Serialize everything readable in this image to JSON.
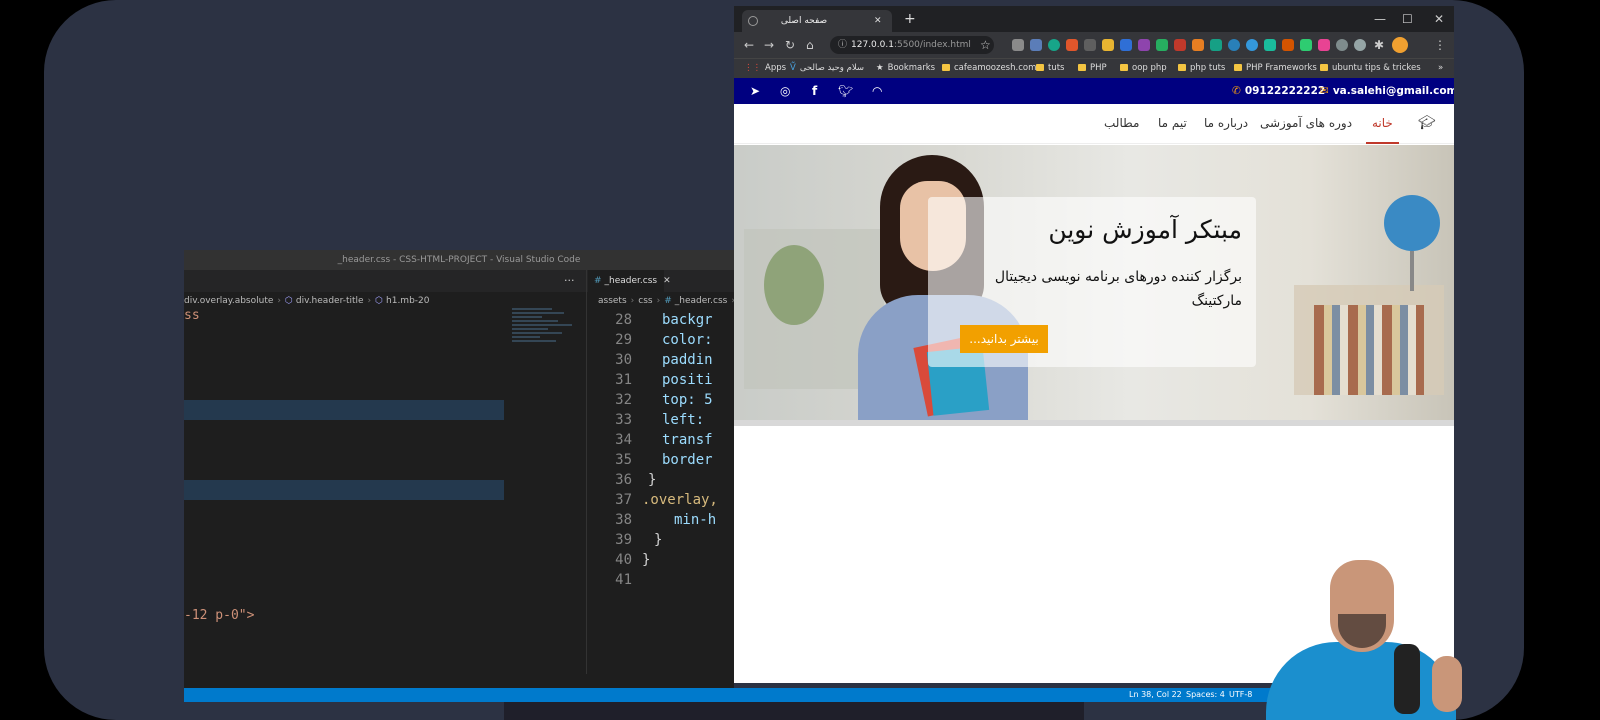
{
  "vscode": {
    "title": "_header.css - CSS-HTML-PROJECT - Visual Studio Code",
    "tab_label": "_header.css",
    "tab_close": "✕",
    "more": "···",
    "left_breadcrumb": [
      "div.overlay.absolute",
      "div.header-title",
      "h1.mb-20"
    ],
    "right_breadcrumb": [
      "assets",
      "css",
      "_header.css",
      "{}"
    ],
    "left_code": {
      "top_fragment": "ss",
      "bottom_fragment": "-12 p-0\">"
    },
    "right_code": [
      {
        "n": "28",
        "p": "backgr"
      },
      {
        "n": "29",
        "p": "color:"
      },
      {
        "n": "30",
        "p": "paddin"
      },
      {
        "n": "31",
        "p": "positi"
      },
      {
        "n": "32",
        "p": "top: 5"
      },
      {
        "n": "33",
        "p": "left: "
      },
      {
        "n": "34",
        "p": "transf"
      },
      {
        "n": "35",
        "p": "border"
      },
      {
        "n": "36",
        "p": "}"
      },
      {
        "n": "37",
        "p": ".overlay,"
      },
      {
        "n": "38",
        "p": "min-h"
      },
      {
        "n": "39",
        "p": "}"
      },
      {
        "n": "40",
        "p": "}"
      },
      {
        "n": "41",
        "p": ""
      }
    ],
    "status": {
      "position": "Ln 38, Col 22",
      "spaces": "Spaces: 4",
      "encoding": "UTF-8"
    }
  },
  "browser": {
    "tab_title": "صفحه اصلی",
    "tab_close": "✕",
    "new_tab": "+",
    "window_controls": {
      "minimize": "—",
      "maximize": "☐",
      "close": "✕"
    },
    "url_host": "127.0.0.1",
    "url_rest": ":5500/index.html",
    "bookmarks": [
      {
        "label": "Apps",
        "type": "apps"
      },
      {
        "label": "سلام وحید صالحی",
        "type": "site"
      },
      {
        "label": "Bookmarks",
        "type": "star"
      },
      {
        "label": "cafeamoozesh.com",
        "type": "folder"
      },
      {
        "label": "tuts",
        "type": "folder"
      },
      {
        "label": "PHP",
        "type": "folder"
      },
      {
        "label": "oop php",
        "type": "folder"
      },
      {
        "label": "php tuts",
        "type": "folder"
      },
      {
        "label": "PHP Frameworks",
        "type": "folder"
      },
      {
        "label": "ubuntu tips & trickes",
        "type": "folder"
      }
    ],
    "bookmarks_more": "»"
  },
  "site": {
    "email": "va.salehi@gmail.com",
    "phone": "09122222222",
    "social_icons": [
      "rss-icon",
      "twitter-icon",
      "facebook-icon",
      "instagram-icon",
      "telegram-icon"
    ],
    "nav": [
      {
        "label": "خانه",
        "active": true
      },
      {
        "label": "دوره های آموزشی",
        "active": false
      },
      {
        "label": "درباره ما",
        "active": false
      },
      {
        "label": "تیم ما",
        "active": false
      },
      {
        "label": "مطالب",
        "active": false
      }
    ],
    "hero": {
      "title": "مبتکر آموزش نوین",
      "subtitle": "برگزار کننده دورهای برنامه نویسی دیجیتال مارکتینگ",
      "button": "بیشتر بدانید..."
    },
    "colors": {
      "topbar": "#000080",
      "active_nav": "#c0392b",
      "button": "#f2a000",
      "accent_icon": "#f39c12"
    }
  }
}
